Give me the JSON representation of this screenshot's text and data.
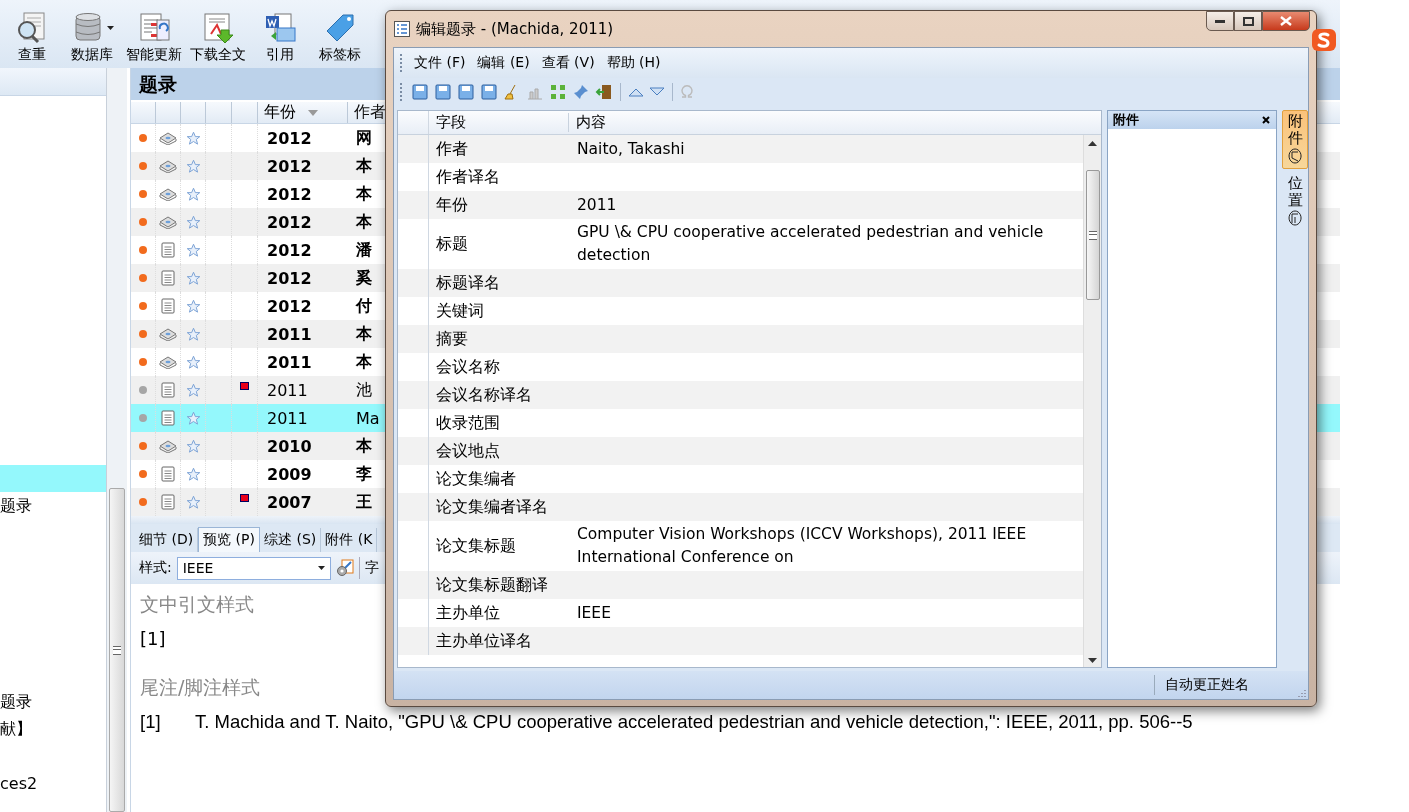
{
  "toolbar": {
    "buttons": [
      {
        "label": "查重",
        "kind": "duplicate",
        "dropdown": false
      },
      {
        "label": "数据库",
        "kind": "database",
        "dropdown": true
      },
      {
        "label": "智能更新",
        "kind": "update",
        "dropdown": false
      },
      {
        "label": "下载全文",
        "kind": "download",
        "dropdown": false
      },
      {
        "label": "引用",
        "kind": "cite",
        "dropdown": false
      },
      {
        "label": "标签标",
        "kind": "tag",
        "dropdown": false
      }
    ]
  },
  "left_pane": {
    "items": [
      {
        "selected": true
      },
      {
        "label": "题录",
        "selected": false
      },
      {
        "label": "题录",
        "selected": false
      },
      {
        "label": "献】",
        "selected": false
      },
      {
        "label": "ces2",
        "selected": false
      }
    ]
  },
  "reference_list": {
    "title": "题录",
    "columns": [
      {
        "label": "年份",
        "sorted": true
      },
      {
        "label": "作者",
        "sorted": false
      }
    ],
    "rows": [
      {
        "read": false,
        "kind": "book",
        "year": "2012",
        "author": "网",
        "flagged": false,
        "selected": false
      },
      {
        "read": false,
        "kind": "book",
        "year": "2012",
        "author": "本",
        "flagged": false,
        "selected": false
      },
      {
        "read": false,
        "kind": "book",
        "year": "2012",
        "author": "本",
        "flagged": false,
        "selected": false
      },
      {
        "read": false,
        "kind": "book",
        "year": "2012",
        "author": "本",
        "flagged": false,
        "selected": false
      },
      {
        "read": false,
        "kind": "document",
        "year": "2012",
        "author": "潘",
        "flagged": false,
        "selected": false
      },
      {
        "read": false,
        "kind": "document",
        "year": "2012",
        "author": "奚",
        "flagged": false,
        "selected": false
      },
      {
        "read": false,
        "kind": "document",
        "year": "2012",
        "author": "付",
        "flagged": false,
        "selected": false
      },
      {
        "read": false,
        "kind": "book",
        "year": "2011",
        "author": "本",
        "flagged": false,
        "selected": false
      },
      {
        "read": false,
        "kind": "book",
        "year": "2011",
        "author": "本",
        "flagged": false,
        "selected": false
      },
      {
        "read": true,
        "kind": "document",
        "year": "2011",
        "author": "池",
        "flagged": true,
        "selected": false
      },
      {
        "read": true,
        "kind": "document",
        "year": "2011",
        "author": "Ma",
        "flagged": false,
        "selected": true
      },
      {
        "read": false,
        "kind": "book",
        "year": "2010",
        "author": "本",
        "flagged": false,
        "selected": false
      },
      {
        "read": false,
        "kind": "document",
        "year": "2009",
        "author": "李",
        "flagged": false,
        "selected": false
      },
      {
        "read": false,
        "kind": "document",
        "year": "2007",
        "author": "王",
        "flagged": true,
        "selected": false
      }
    ]
  },
  "preview_panel": {
    "tabs": [
      {
        "label": "细节 (D)",
        "selected": false
      },
      {
        "label": "预览 (P)",
        "selected": true
      },
      {
        "label": "综述 (S)",
        "selected": false
      },
      {
        "label": "附件 (K",
        "selected": false
      }
    ],
    "style_label": "样式:",
    "style_value": "IEEE",
    "toolbar_text": "字",
    "intext_heading": "文中引文样式",
    "intext_citation": "[1]",
    "bibliography_heading": "尾注/脚注样式",
    "bibliography": [
      {
        "number": "[1]",
        "text": "T. Machida and T. Naito, \"GPU \\& CPU cooperative accelerated pedestrian and vehicle detection,\": IEEE, 2011, pp. 506--5"
      }
    ]
  },
  "dialog": {
    "title": "编辑题录 - (Machida, 2011)",
    "menu": [
      "文件 (F)",
      "编辑 (E)",
      "查看 (V)",
      "帮助 (H)"
    ],
    "columns": [
      "字段",
      "内容"
    ],
    "fields": [
      {
        "field": "作者",
        "value": "Naito, Takashi"
      },
      {
        "field": "作者译名"
      },
      {
        "field": "年份",
        "value": "2011"
      },
      {
        "field": "标题",
        "value": "GPU \\& CPU cooperative accelerated pedestrian and vehicle detection"
      },
      {
        "field": "标题译名"
      },
      {
        "field": "关键词"
      },
      {
        "field": "摘要"
      },
      {
        "field": "会议名称"
      },
      {
        "field": "会议名称译名"
      },
      {
        "field": "收录范围"
      },
      {
        "field": "会议地点"
      },
      {
        "field": "论文集编者"
      },
      {
        "field": "论文集编者译名"
      },
      {
        "field": "论文集标题",
        "value": "Computer Vision Workshops (ICCV Workshops), 2011 IEEE International Conference on"
      },
      {
        "field": "论文集标题翻译"
      },
      {
        "field": "主办单位",
        "value": "IEEE"
      },
      {
        "field": "主办单位译名"
      }
    ],
    "attachment_panel": {
      "title": "附件"
    },
    "side_tabs": [
      {
        "label": "附件",
        "selected": true
      },
      {
        "label": "位置",
        "selected": false
      }
    ],
    "status": "自动更正姓名"
  }
}
